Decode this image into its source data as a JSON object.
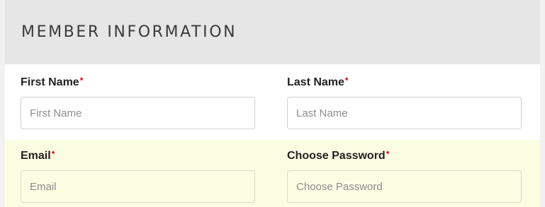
{
  "section": {
    "title": "MEMBER INFORMATION"
  },
  "required_marker": "*",
  "colors": {
    "header_bg": "#e6e6e6",
    "highlight_row_bg": "#fbfde3",
    "required": "#d0021b"
  },
  "fields": {
    "first_name": {
      "label": "First Name",
      "placeholder": "First Name",
      "value": ""
    },
    "last_name": {
      "label": "Last Name",
      "placeholder": "Last Name",
      "value": ""
    },
    "email": {
      "label": "Email",
      "placeholder": "Email",
      "value": ""
    },
    "password": {
      "label": "Choose Password",
      "placeholder": "Choose Password",
      "value": ""
    }
  }
}
